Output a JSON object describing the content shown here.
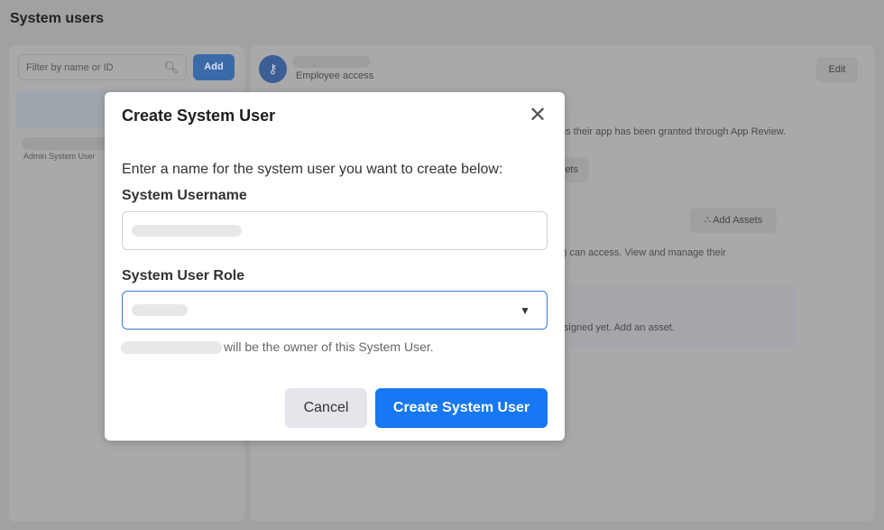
{
  "page": {
    "title": "System users"
  },
  "left": {
    "search_placeholder": "Filter by name or ID",
    "add_label": "Add",
    "list_item_role": "Admin System User"
  },
  "right": {
    "access_label": "Employee access",
    "edit_label": "Edit",
    "app_review_text": "ns their app has been granted through App Review.",
    "assets_tab_fragment": "ets",
    "add_assets_label": "Add Assets",
    "access_text": "r) can access. View and manage their",
    "empty_text": "signed yet. Add an asset."
  },
  "modal": {
    "title": "Create System User",
    "description": "Enter a name for the system user you want to create below:",
    "username_label": "System Username",
    "role_label": "System User Role",
    "owner_text": "will be the owner of this System User.",
    "cancel_label": "Cancel",
    "create_label": "Create System User"
  },
  "colors": {
    "primary": "#1877f2",
    "focus_border": "#3b7be0"
  }
}
